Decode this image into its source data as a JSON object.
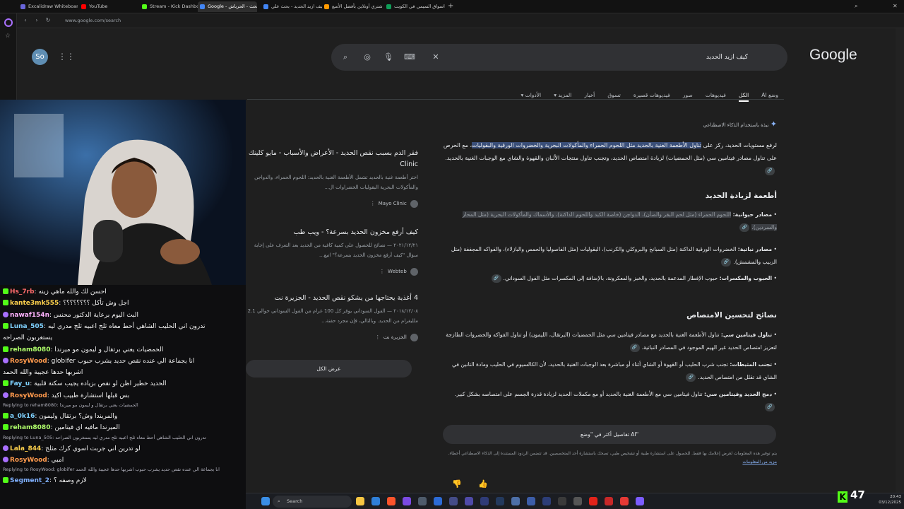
{
  "browser": {
    "tabs": [
      {
        "label": "Excalidraw Whiteboard",
        "color": "#6965db"
      },
      {
        "label": "YouTube",
        "color": "#ff0000"
      },
      {
        "label": "Stream - Kick Dashboard",
        "color": "#53fc18"
      },
      {
        "label": "Google - بحث - الحرباش",
        "color": "#4285f4"
      },
      {
        "label": "كيف ازيد الحديد - بحث علي",
        "color": "#4285f4"
      },
      {
        "label": "اشتري أونلاين بأفضل الأسع",
        "color": "#ff9900"
      },
      {
        "label": "اسواق التميمي في الكويت",
        "color": "#0f9d58"
      }
    ],
    "url": "www.google.com/search"
  },
  "google": {
    "logo": "Google",
    "query": "كيف ازيد الحديد",
    "avatar": "So",
    "nav_tabs": [
      "وضع AI",
      "الكل",
      "فيديوهات",
      "صور",
      "فيديوهات قصيرة",
      "تسوق",
      "أخبار",
      "المزيد",
      "الأدوات"
    ],
    "ai_overview": {
      "header": "نبذة باستخدام الذكاء الاصطناعي",
      "intro_pre": "لرفع مستويات الحديد، ركز على ",
      "intro_hl": "تناول الأطعمة الغنية بالحديد مثل اللحوم الحمراء والمأكولات البحرية والخضروات الورقية والبقوليات",
      "intro_post": "، مع الحرص على تناول مصادر فيتامين سي (مثل الحمضيات) لزيادة امتصاص الحديد، وتجنب تناول منتجات الألبان والقهوة والشاي مع الوجبات الغنية بالحديد.",
      "section1_title": "أطعمة لزيادة الحديد",
      "section1_items": [
        {
          "bold": "مصادر حيوانية:",
          "text": "اللحوم الحمراء (مثل لحم البقر والضأن)، الدواجن (خاصة الكبد واللحوم الداكنة)، والأسماك والمأكولات البحرية (مثل المحار والسردين)."
        },
        {
          "bold": "مصادر نباتية:",
          "text": "الخضروات الورقية الداكنة (مثل السبانخ والبروكلي والكرنب)، البقوليات (مثل الفاصوليا والحمص والبازلاء)، والفواكه المجففة (مثل الزبيب والمشمش)."
        },
        {
          "bold": "الحبوب والمكسرات:",
          "text": "حبوب الإفطار المدعمة بالحديد، والخبز والمعكرونة، بالإضافة إلى المكسرات مثل الفول السوداني."
        }
      ],
      "section2_title": "نصائح لتحسين الامتصاص",
      "section2_items": [
        {
          "bold": "تناول فيتامين سي:",
          "text": "تناول الأطعمة الغنية بالحديد مع مصادر فيتامين سي مثل الحمضيات (البرتقال، الليمون) أو تناول الفواكه والخضروات الطازجة لتعزيز امتصاص الحديد غير الهيم الموجود في المصادر النباتية."
        },
        {
          "bold": "تجنب المثبطات:",
          "text": "تجنب شرب الحليب أو القهوة أو الشاي أثناء أو مباشرة بعد الوجبات الغنية بالحديد، لأن الكالسيوم في الحليب ومادة التانين في الشاي قد تقلل من امتصاص الحديد."
        },
        {
          "bold": "دمج الحديد وفيتامين سي:",
          "text": "تناول فيتامين سي مع الأطعمة الغنية بالحديد أو مع مكملات الحديد لزيادة قدرة الجسم على امتصاصه بشكل كبير."
        }
      ],
      "more_button": "تفاصيل أكثر في \"وضع AI\"",
      "disclaimer": "يتم توفير هذه المعلومات لغرض إعلامك بها فقط. للحصول على استشارة طبية أو تشخيص طبي، تصحك باستشارة أحد المتخصصين. قد تتضمن الردود المستندة إلى الذكاء الاصطناعي أخطاء.",
      "disclaimer_link": "مزيد من المعلومات"
    },
    "sources": [
      {
        "title": "فقر الدم بسبب نقص الحديد - الأعراض والأسباب - مايو كلينك Clinic",
        "snippet": "اختر أطعمة غنية بالحديد تشمل الأطعمة الغنية بالحديد: اللحوم الحمراء، والدواجن والمأكولات البحرية البقوليات الخضراوات ال...",
        "site": "Mayo Clinic"
      },
      {
        "title": "كيف أرفع مخزون الحديد بسرعة؟ - ويب طب",
        "snippet": "٢٠٢١/١٢/٢١ — نصائح للحصول على كمية كافية من الحديد بعد التعرف على إجابة سؤال \"كيف أرفع مخزون الحديد بسرعة؟\" اتبع...",
        "site": "Webteb"
      },
      {
        "title": "4 أغذية يحتاجها من يشكو نقص الحديد - الجزيرة نت",
        "snippet": "٢٠١٨/١٢/٠٨ — الفول السوداني يوفر كل 100 غرام من الفول السوداني حوالي 2.1 ملليغرام من الحديد. وبالتالي، فإن مجرد حفنة...",
        "site": "الجزيرة نت"
      }
    ],
    "show_all": "عرض الكل"
  },
  "chat": [
    {
      "type": "msg",
      "user": "Hs_7rb",
      "color": "#ff6b6b",
      "text": "احسن لك والله ماهي زينه",
      "icon": "k"
    },
    {
      "type": "msg",
      "user": "kante3mk555",
      "color": "#ffd24d",
      "text": "اجل وش تأكل ؟؟؟؟؟؟؟؟",
      "icon": "k"
    },
    {
      "type": "msg",
      "user": "nawaf154n",
      "color": "#ffb3ff",
      "text": "البث اليوم برعاية الدكتور محنس",
      "icon": "p"
    },
    {
      "type": "msg",
      "user": "Luna_505",
      "color": "#7fd1ff",
      "text": "تدرون اني الحليب الشاهي أحط معاه ثلج اعبيه ثلج مدري ليه",
      "icon": "k"
    },
    {
      "type": "cont",
      "text": "يستغربون الصراحه"
    },
    {
      "type": "msg",
      "user": "reham8080",
      "color": "#b0ff6b",
      "text": "الحمضيات يعني برتقال و ليمون مو ميرندا",
      "icon": "k"
    },
    {
      "type": "msg",
      "user": "RosyWood",
      "color": "#ff9a4d",
      "text": "globifer انا يجماعة الي عنده نقص حديد يشرب حبوب",
      "icon": "p"
    },
    {
      "type": "cont",
      "text": "اشربها حدها عجيبة والله الحمد"
    },
    {
      "type": "msg",
      "user": "Fay_u",
      "color": "#7fd1ff",
      "text": "الحديد خطير اظن لو نقص بزياده يجيب سكتة قلبية",
      "icon": "k"
    },
    {
      "type": "msg",
      "user": "RosyWood",
      "color": "#ff9a4d",
      "text": "بس قبلها استشارة طبيب اكيد",
      "icon": "p"
    },
    {
      "type": "reply",
      "text": "Replying to reham8080: الحمضيات يعني برتقال و ليمون مو ميرندا"
    },
    {
      "type": "msg",
      "user": "a_0k16",
      "color": "#7fd1ff",
      "text": "والمريندا وش؟ برتقال وليمون",
      "icon": "k"
    },
    {
      "type": "msg",
      "user": "reham8080",
      "color": "#b0ff6b",
      "text": "الميرندا مافيه اي فيتامين",
      "icon": "k"
    },
    {
      "type": "reply",
      "text": "Replying to Luna_505: تدرون اني الحليب الشاهي أحط معاه ثلج اعبيه ثلج مدري ليه يستغربون الصراحه"
    },
    {
      "type": "msg",
      "user": "Lala_844",
      "color": "#ffd24d",
      "text": "لو تدرين اني جربت اسوي كرك مثلج",
      "icon": "p"
    },
    {
      "type": "msg",
      "user": "RosyWood",
      "color": "#ff9a4d",
      "text": "امبي",
      "icon": "p"
    },
    {
      "type": "reply",
      "text": "Replying to RosyWood: globifer انا يجماعة الي عنده نقص حديد يشرب حبوب اشربها حدها عجيبة والله الحمد"
    },
    {
      "type": "msg",
      "user": "Segment_2",
      "color": "#7fb0ff",
      "text": "لازم وصفه ؟",
      "icon": "k"
    }
  ],
  "taskbar": {
    "search": "Search",
    "viewers": "47",
    "time": "20:43",
    "date": "03/12/2025"
  }
}
